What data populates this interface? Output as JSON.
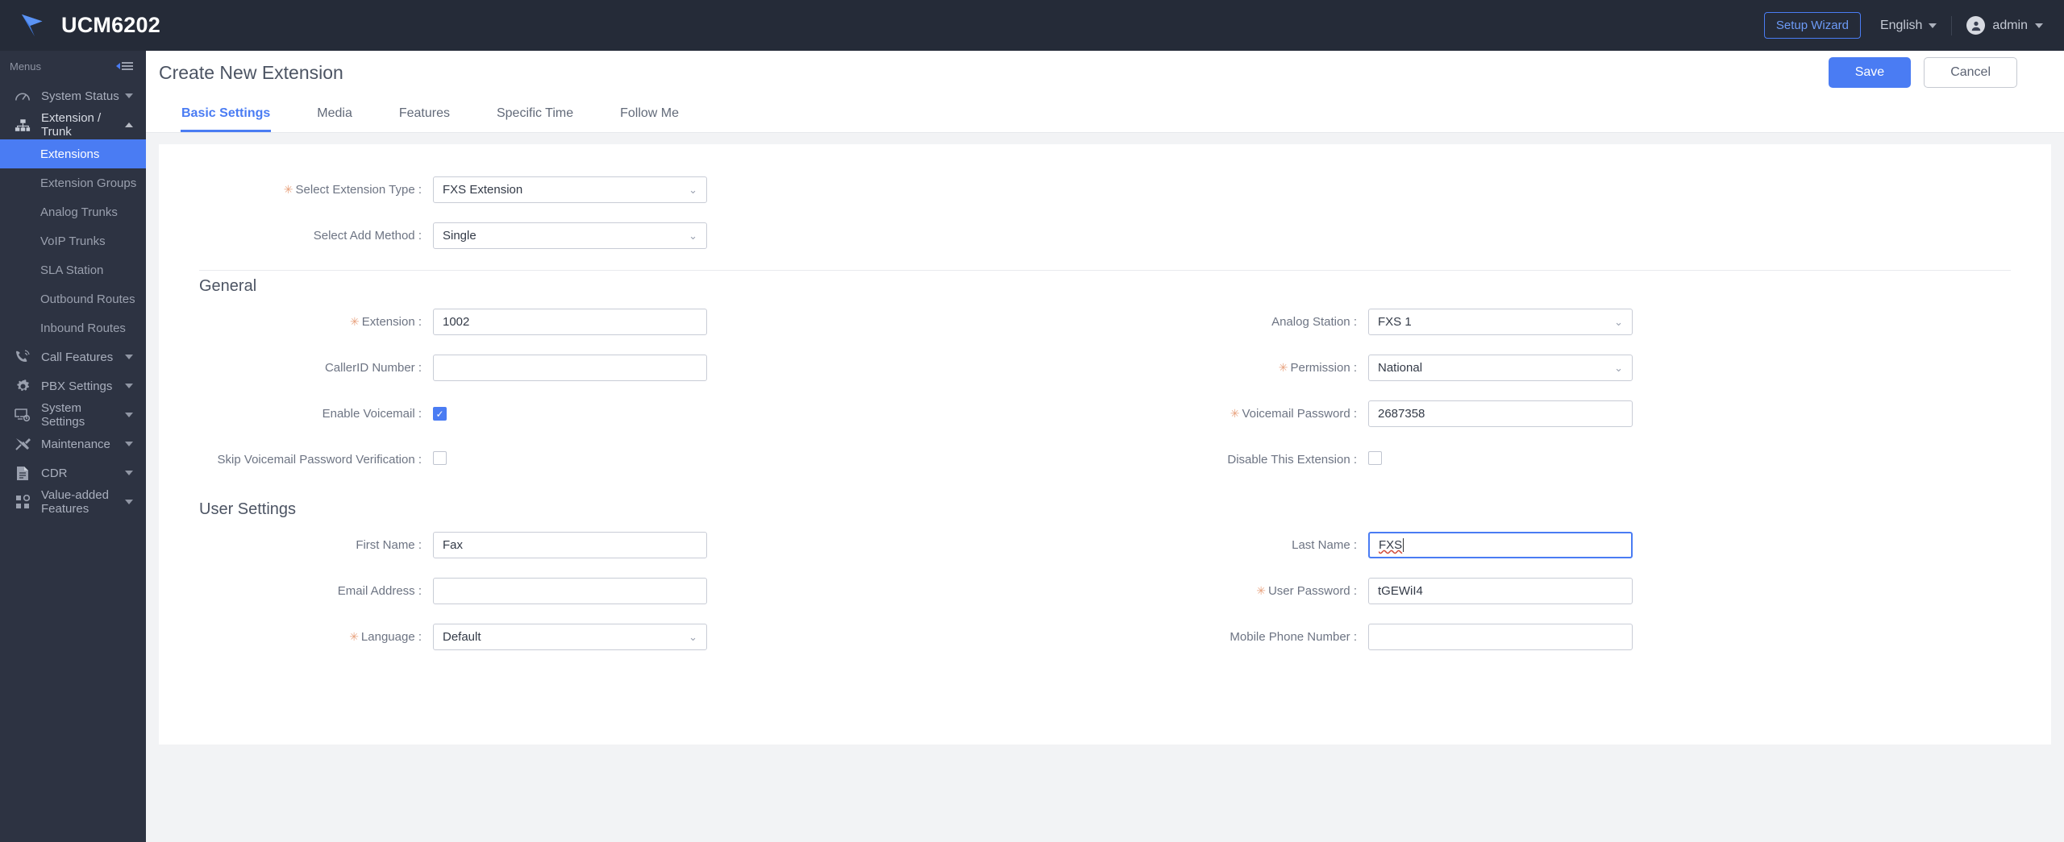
{
  "topbar": {
    "brand": "UCM6202",
    "setup_wizard": "Setup Wizard",
    "language": "English",
    "user": "admin"
  },
  "sidebar": {
    "menus_label": "Menus",
    "items": [
      {
        "label": "System Status",
        "icon": "gauge-icon",
        "chevron": "down"
      },
      {
        "label": "Extension / Trunk",
        "icon": "sitemap-icon",
        "chevron": "up"
      },
      {
        "label": "Call Features",
        "icon": "phone-wave-icon",
        "chevron": "down"
      },
      {
        "label": "PBX Settings",
        "icon": "gear-icon",
        "chevron": "down"
      },
      {
        "label": "System Settings",
        "icon": "monitor-gear-icon",
        "chevron": "down"
      },
      {
        "label": "Maintenance",
        "icon": "tools-icon",
        "chevron": "down"
      },
      {
        "label": "CDR",
        "icon": "document-icon",
        "chevron": "down"
      },
      {
        "label": "Value-added Features",
        "icon": "grid-icon",
        "chevron": "down"
      }
    ],
    "sub_items": [
      {
        "label": "Extensions",
        "active": true
      },
      {
        "label": "Extension Groups",
        "active": false
      },
      {
        "label": "Analog Trunks",
        "active": false
      },
      {
        "label": "VoIP Trunks",
        "active": false
      },
      {
        "label": "SLA Station",
        "active": false
      },
      {
        "label": "Outbound Routes",
        "active": false
      },
      {
        "label": "Inbound Routes",
        "active": false
      }
    ]
  },
  "page": {
    "title": "Create New Extension",
    "save_label": "Save",
    "cancel_label": "Cancel"
  },
  "tabs": [
    {
      "label": "Basic Settings",
      "active": true
    },
    {
      "label": "Media",
      "active": false
    },
    {
      "label": "Features",
      "active": false
    },
    {
      "label": "Specific Time",
      "active": false
    },
    {
      "label": "Follow Me",
      "active": false
    }
  ],
  "form": {
    "extension_type": {
      "label": "Select Extension Type :",
      "value": "FXS Extension",
      "required": true
    },
    "add_method": {
      "label": "Select Add Method :",
      "value": "Single",
      "required": false
    },
    "general_title": "General",
    "extension": {
      "label": "Extension :",
      "value": "1002",
      "required": true
    },
    "analog_station": {
      "label": "Analog Station :",
      "value": "FXS 1",
      "required": false
    },
    "callerid_number": {
      "label": "CallerID Number :",
      "value": "",
      "required": false
    },
    "permission": {
      "label": "Permission :",
      "value": "National",
      "required": true
    },
    "enable_voicemail": {
      "label": "Enable Voicemail :",
      "checked": true,
      "required": false
    },
    "voicemail_password": {
      "label": "Voicemail Password :",
      "value": "2687358",
      "required": true
    },
    "skip_voicemail_verification": {
      "label": "Skip Voicemail Password Verification :",
      "checked": false,
      "required": false
    },
    "disable_extension": {
      "label": "Disable This Extension :",
      "checked": false,
      "required": false
    },
    "user_settings_title": "User Settings",
    "first_name": {
      "label": "First Name :",
      "value": "Fax",
      "required": false
    },
    "last_name": {
      "label": "Last Name :",
      "value": "FXS",
      "required": false,
      "focused": true
    },
    "email_address": {
      "label": "Email Address :",
      "value": "",
      "required": false
    },
    "user_password": {
      "label": "User Password :",
      "value": "tGEWiI4",
      "required": true
    },
    "language": {
      "label": "Language :",
      "value": "Default",
      "required": true
    },
    "mobile_phone_number": {
      "label": "Mobile Phone Number :",
      "value": "",
      "required": false
    }
  },
  "colors": {
    "accent": "#4a7cf3",
    "topbar_bg": "#252b38",
    "sidebar_bg": "#2d3342",
    "content_bg": "#f2f3f5",
    "required_star": "#e8a27e"
  }
}
